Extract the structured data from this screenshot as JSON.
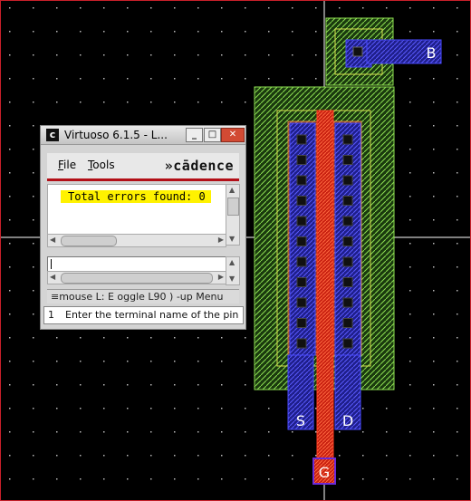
{
  "canvas": {
    "background": "#000000",
    "grid_dot_color": "#b8b8b8",
    "layers": {
      "nwell": "#7fd34a",
      "oxide": "#e0a050",
      "metal1": "#2d2dcf",
      "poly": "#d6261b",
      "contact": "#111111"
    },
    "pins": {
      "bulk": "B",
      "source": "S",
      "drain": "D",
      "gate": "G"
    }
  },
  "ciw": {
    "title": "Virtuoso 6.1.5 - L...",
    "app_icon": "c",
    "menu": {
      "file": "File",
      "tools": "Tools"
    },
    "logo": "»cādence",
    "output_text": "Total errors found: 0",
    "output_highlight": "#fff200",
    "mouse_bar": "≡mouse L: E oggle L90 ) -up Menu",
    "prompt_number": "1",
    "prompt_text": "Enter the terminal name of the pin"
  }
}
